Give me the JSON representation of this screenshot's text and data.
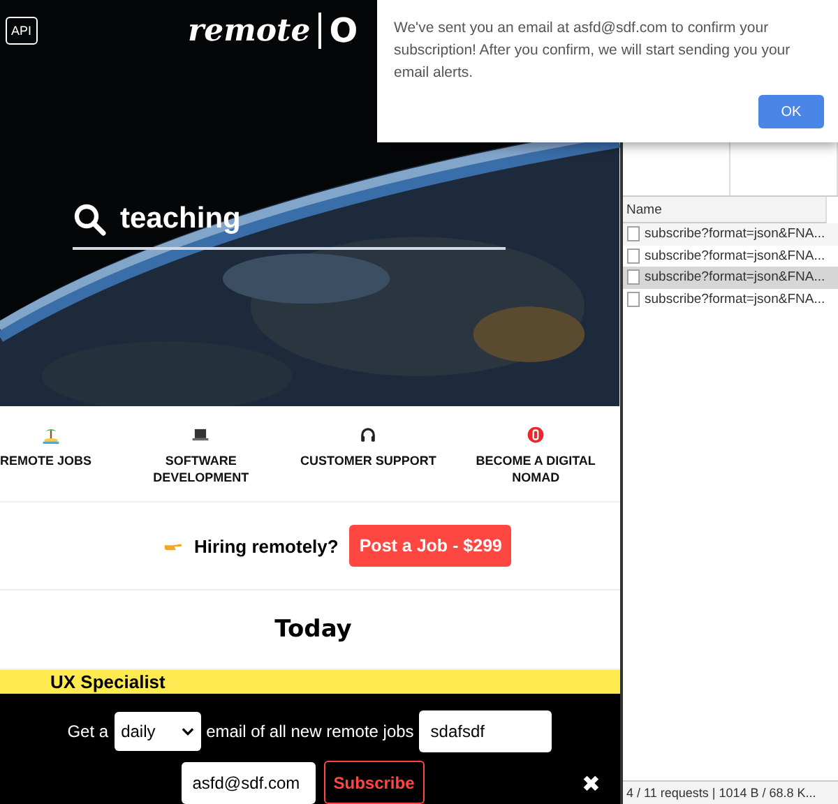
{
  "header": {
    "api_button": "API",
    "logo_script": "remote",
    "logo_cut": "O"
  },
  "search": {
    "value": "teaching"
  },
  "categories": [
    {
      "label": "REMOTE JOBS"
    },
    {
      "label": "SOFTWARE DEVELOPMENT"
    },
    {
      "label": "CUSTOMER SUPPORT"
    },
    {
      "label": "BECOME A DIGITAL NOMAD"
    }
  ],
  "hiring": {
    "text": "Hiring remotely?",
    "button": "Post a Job - $299"
  },
  "section_title": "Today",
  "job": {
    "title": "UX Specialist"
  },
  "subscribe_bar": {
    "prefix": "Get a",
    "frequency": "daily",
    "middle": "email of all new remote jobs",
    "search_value": "sdafsdf",
    "email_value": "asfd@sdf.com",
    "button": "Subscribe",
    "close": "✖"
  },
  "dialog": {
    "message": "We've sent you an email at asfd@sdf.com to confirm your subscription! After you confirm, we will start sending you your email alerts.",
    "button": "OK"
  },
  "devtools": {
    "column": "Name",
    "rows": [
      {
        "name": "subscribe?format=json&FNA...",
        "selected": false
      },
      {
        "name": "subscribe?format=json&FNA...",
        "selected": false
      },
      {
        "name": "subscribe?format=json&FNA...",
        "selected": true
      },
      {
        "name": "subscribe?format=json&FNA...",
        "selected": false
      }
    ],
    "status": "4 / 11 requests | 1014 B / 68.8 K..."
  }
}
